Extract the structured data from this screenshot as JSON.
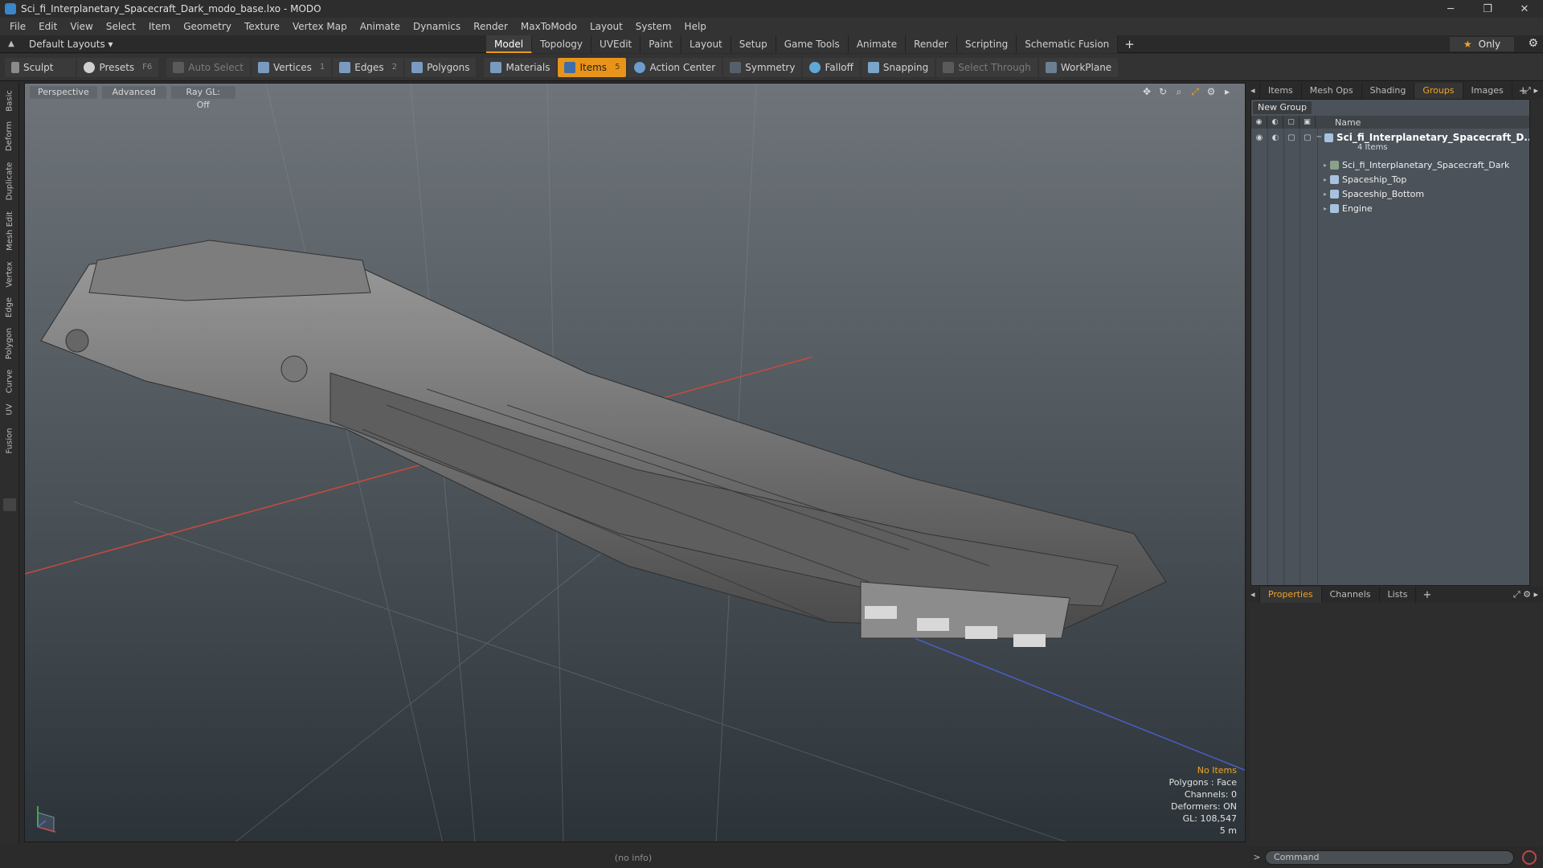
{
  "window": {
    "title": "Sci_fi_Interplanetary_Spacecraft_Dark_modo_base.lxo - MODO",
    "controls": [
      "─",
      "❐",
      "✕"
    ]
  },
  "menu": [
    "File",
    "Edit",
    "View",
    "Select",
    "Item",
    "Geometry",
    "Texture",
    "Vertex Map",
    "Animate",
    "Dynamics",
    "Render",
    "MaxToModo",
    "Layout",
    "System",
    "Help"
  ],
  "layout": {
    "name": "Default Layouts ▾",
    "tabs": [
      "Model",
      "Topology",
      "UVEdit",
      "Paint",
      "Layout",
      "Setup",
      "Game Tools",
      "Animate",
      "Render",
      "Scripting",
      "Schematic Fusion"
    ],
    "active_tab": "Model",
    "add": "+",
    "only_label": "Only"
  },
  "toolbar": {
    "sculpt": "Sculpt",
    "presets": "Presets",
    "presets_key": "F6",
    "auto_select": "Auto Select",
    "vertices": "Vertices",
    "vertices_key": "1",
    "edges": "Edges",
    "edges_key": "2",
    "polygons": "Polygons",
    "materials": "Materials",
    "items": "Items",
    "items_key": "5",
    "action_center": "Action Center",
    "symmetry": "Symmetry",
    "falloff": "Falloff",
    "snapping": "Snapping",
    "select_through": "Select Through",
    "workplane": "WorkPlane"
  },
  "left_tabs": [
    "Basic",
    "Deform",
    "Duplicate",
    "Mesh Edit",
    "Vertex",
    "Edge",
    "Polygon",
    "Curve",
    "UV",
    "Fusion"
  ],
  "viewport": {
    "view": "Perspective",
    "mode": "Advanced",
    "raygl": "Ray GL: Off",
    "info": {
      "selection": "No Items",
      "polygons": "Polygons : Face",
      "channels": "Channels: 0",
      "deformers": "Deformers: ON",
      "gl": "GL: 108,547",
      "scale": "5 m"
    }
  },
  "status": "(no info)",
  "right_panel": {
    "top_tabs": [
      "Items",
      "Mesh Ops",
      "Shading",
      "Groups",
      "Images"
    ],
    "active_top_tab": "Groups",
    "new_group": "New Group",
    "header_name": "Name",
    "group": {
      "name": "Sci_fi_Interplanetary_Spacecraft_D...",
      "count": "4 Items",
      "children": [
        "Sci_fi_Interplanetary_Spacecraft_Dark",
        "Spaceship_Top",
        "Spaceship_Bottom",
        "Engine"
      ]
    },
    "bottom_tabs": [
      "Properties",
      "Channels",
      "Lists"
    ],
    "active_bottom_tab": "Properties",
    "command_placeholder": "Command"
  },
  "colors": {
    "accent": "#e8941b",
    "viewport_top": "#6e747a",
    "viewport_bottom": "#2c3338"
  }
}
